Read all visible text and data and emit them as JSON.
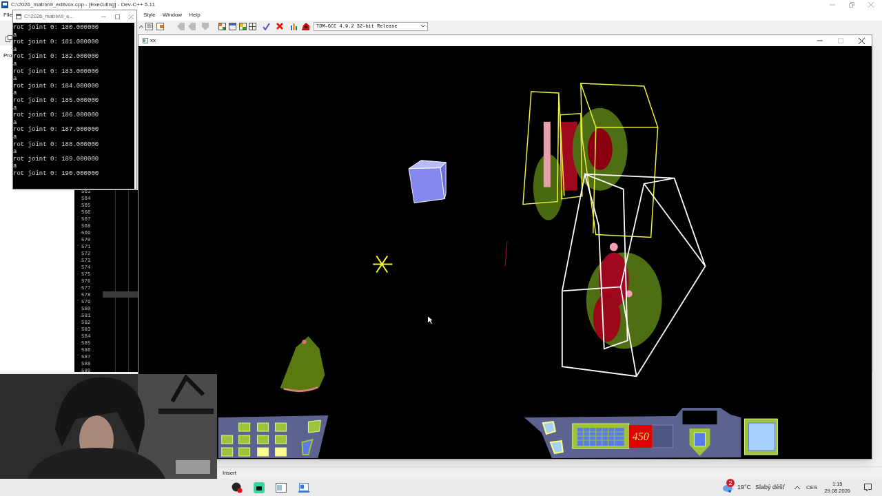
{
  "devcpp": {
    "title": "C:\\2026_matrix\\9_editvox.cpp - [Executing] - Dev-C++ 5.11",
    "menu": [
      "File",
      "Style",
      "Window",
      "Help"
    ],
    "compiler": "TDM-GCC 4.9.2 32-bit Release",
    "panel_tab": "Pro",
    "line_numbers": [
      "563",
      "564",
      "565",
      "566",
      "567",
      "568",
      "569",
      "570",
      "571",
      "572",
      "573",
      "574",
      "575",
      "576",
      "577",
      "578",
      "579",
      "580",
      "581",
      "582",
      "583",
      "584",
      "585",
      "586",
      "587",
      "588",
      "589"
    ],
    "status": "Insert"
  },
  "console": {
    "title": "C:\\2026_matrix\\9_e...",
    "lines": [
      "rot joint 0: 180.000000",
      "a",
      "rot joint 0: 181.000000",
      "a",
      "rot joint 0: 182.000000",
      "a",
      "rot joint 0: 183.000000",
      "a",
      "rot joint 0: 184.000000",
      "a",
      "rot joint 0: 185.000000",
      "a",
      "rot joint 0: 186.000000",
      "a",
      "rot joint 0: 187.000000",
      "a",
      "rot joint 0: 188.000000",
      "a",
      "rot joint 0: 189.000000",
      "a",
      "rot joint 0: 190.000000"
    ]
  },
  "game_window": {
    "title": "xx",
    "hud": {
      "counter": "450"
    }
  },
  "taskbar": {
    "weather": {
      "badge": "2",
      "temperature": "19°C",
      "condition": "Slabý déšť"
    },
    "language": "CES",
    "time": "1:15",
    "date": "29.08.2026"
  }
}
